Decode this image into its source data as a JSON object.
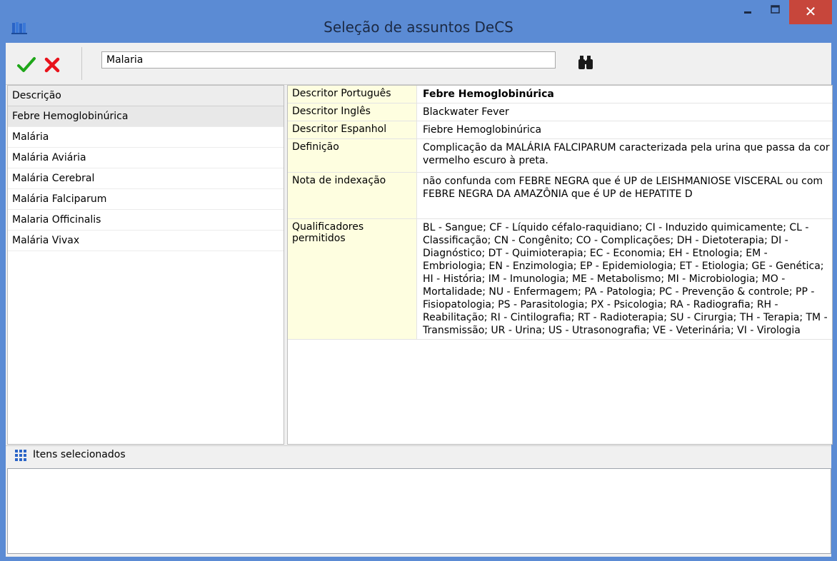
{
  "window": {
    "title": "Seleção de assuntos DeCS",
    "close_glyph": "✕",
    "icons": {
      "app": "books-icon",
      "minimize": "minimize-icon",
      "maximize": "maximize-icon",
      "close": "close-icon"
    },
    "colors": {
      "titlebar": "#5b8bd4",
      "close": "#c7463b"
    }
  },
  "toolbar": {
    "confirm_icon": "checkmark-icon",
    "cancel_icon": "x-mark-icon",
    "search_value": "Malaria",
    "find_icon": "binoculars-icon",
    "colors": {
      "confirm": "#1ea619",
      "cancel": "#e8121b"
    }
  },
  "list": {
    "header": "Descrição",
    "items": [
      "Febre Hemoglobinúrica",
      "Malária",
      "Malária Aviária",
      "Malária Cerebral",
      "Malária Falciparum",
      "Malaria Officinalis",
      "Malária Vivax"
    ],
    "selected_index": 0
  },
  "details": {
    "rows": [
      {
        "key": "Descritor Português",
        "value": "Febre Hemoglobinúrica"
      },
      {
        "key": "Descritor Inglês",
        "value": "Blackwater Fever"
      },
      {
        "key": "Descritor Espanhol",
        "value": "Fiebre Hemoglobinúrica"
      },
      {
        "key": "Definição",
        "value": "Complicação da MALÁRIA FALCIPARUM caracterizada pela urina que passa da cor vermelho escuro à preta."
      },
      {
        "key": "Nota de indexação",
        "value": "não confunda com FEBRE NEGRA que é UP de LEISHMANIOSE VISCERAL ou com FEBRE NEGRA DA AMAZÔNIA que é UP de HEPATITE D"
      },
      {
        "key": "Qualificadores permitidos",
        "value": "BL - Sangue; CF - Líquido céfalo-raquidiano; CI - Induzido quimicamente; CL - Classificação; CN - Congênito; CO - Complicações; DH - Dietoterapia; DI - Diagnóstico; DT - Quimioterapia; EC - Economia; EH - Etnologia; EM - Embriologia; EN - Enzimologia; EP - Epidemiologia; ET - Etiologia; GE - Genética; HI - História; IM - Imunologia; ME - Metabolismo; MI - Microbiologia; MO - Mortalidade; NU - Enfermagem; PA - Patologia; PC - Prevenção & controle; PP - Fisiopatologia; PS - Parasitologia; PX - Psicologia; RA - Radiografia; RH - Reabilitação; RI - Cintilografia; RT - Radioterapia; SU - Cirurgia; TH - Terapia; TM - Transmissão; UR - Urina; US - Utrasonografia; VE - Veterinária; VI - Virologia"
      }
    ]
  },
  "selected": {
    "icon": "grid-icon",
    "title": "Itens selecionados"
  }
}
